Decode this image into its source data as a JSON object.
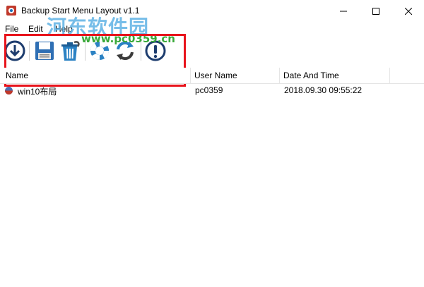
{
  "window": {
    "title": "Backup Start Menu Layout v1.1",
    "controls": {
      "minimize": "minimize-icon",
      "maximize": "maximize-icon",
      "close": "close-icon"
    }
  },
  "menu": [
    "File",
    "Edit",
    "Help"
  ],
  "watermark": {
    "text": "河东软件园",
    "url": "www.pc0359.cn"
  },
  "toolbar": [
    {
      "name": "restore-icon"
    },
    {
      "name": "save-icon"
    },
    {
      "name": "delete-icon"
    },
    {
      "name": "lifebuoy-icon"
    },
    {
      "name": "refresh-icon"
    },
    {
      "name": "about-icon"
    }
  ],
  "table": {
    "columns": [
      "Name",
      "User Name",
      "Date And Time"
    ],
    "rows": [
      {
        "name": "win10布局",
        "user": "pc0359",
        "datetime": "2018.09.30 09:55:22"
      }
    ]
  },
  "colors": {
    "highlight": "#e8141c",
    "watermark": "#5fb2e4",
    "accent": "#0078d7"
  }
}
